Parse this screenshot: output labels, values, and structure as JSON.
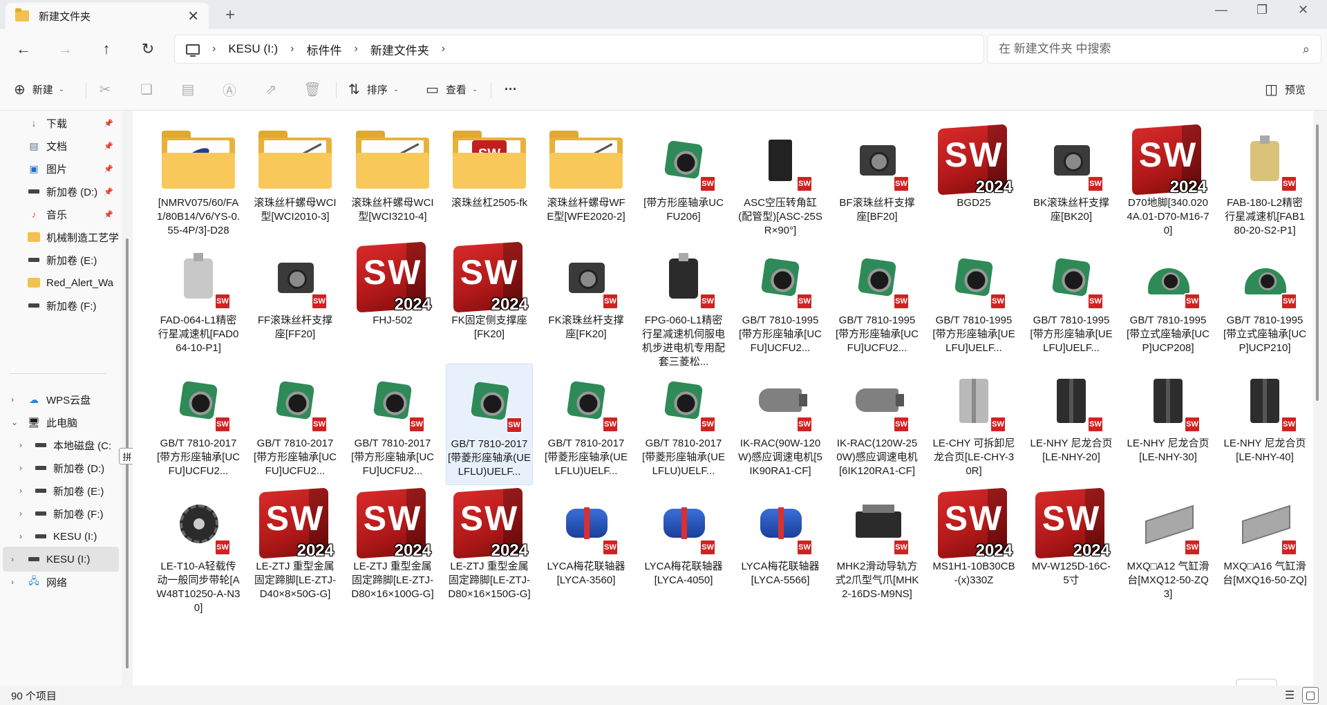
{
  "window": {
    "tab_title": "新建文件夹",
    "close_tab": "✕",
    "new_tab": "+",
    "minimize": "—",
    "restore": "❐",
    "close": "✕"
  },
  "nav": {
    "back": "←",
    "forward": "→",
    "up": "↑",
    "refresh": "↻",
    "breadcrumb": [
      "KESU (I:)",
      "标件件",
      "新建文件夹"
    ],
    "breadcrumb_sep": "›"
  },
  "search": {
    "placeholder": "在 新建文件夹 中搜索",
    "icon": "⌕"
  },
  "toolbar": {
    "new_label": "新建",
    "sort_label": "排序",
    "view_label": "查看",
    "more_label": "···",
    "preview_label": "预览"
  },
  "sidebar": {
    "quick": [
      {
        "label": "下载",
        "icon": "download-icon",
        "pinned": true
      },
      {
        "label": "文档",
        "icon": "document-icon",
        "pinned": true
      },
      {
        "label": "图片",
        "icon": "picture-icon",
        "pinned": true
      },
      {
        "label": "新加卷 (D:)",
        "icon": "drive-icon",
        "pinned": true
      },
      {
        "label": "音乐",
        "icon": "music-icon",
        "pinned": true
      },
      {
        "label": "机械制造工艺学",
        "icon": "folder-icon",
        "pinned": false
      },
      {
        "label": "新加卷 (E:)",
        "icon": "drive-icon",
        "pinned": false
      },
      {
        "label": "Red_Alert_Wa",
        "icon": "folder-icon",
        "pinned": false
      },
      {
        "label": "新加卷 (F:)",
        "icon": "drive-icon",
        "pinned": false
      }
    ],
    "tree": [
      {
        "label": "WPS云盘",
        "level": 0,
        "expander": "›"
      },
      {
        "label": "此电脑",
        "level": 0,
        "expander": "⌄"
      },
      {
        "label": "本地磁盘 (C:",
        "level": 1,
        "expander": "›"
      },
      {
        "label": "新加卷 (D:)",
        "level": 1,
        "expander": "›"
      },
      {
        "label": "新加卷 (E:)",
        "level": 1,
        "expander": "›"
      },
      {
        "label": "新加卷 (F:)",
        "level": 1,
        "expander": "›"
      },
      {
        "label": "KESU (I:)",
        "level": 1,
        "expander": "›"
      },
      {
        "label": "KESU (I:)",
        "level": 0,
        "expander": "›"
      },
      {
        "label": "网络",
        "level": 0,
        "expander": "›"
      }
    ],
    "ime_label": "拼"
  },
  "files": [
    {
      "name": "[NMRV075/60/FA1/80B14/V6/YS-0.55-4P/3]-D28",
      "kind": "folder-blob"
    },
    {
      "name": "滚珠丝杆螺母WCI型[WCI2010-3]",
      "kind": "folder-rod"
    },
    {
      "name": "滚珠丝杆螺母WCI型[WCI3210-4]",
      "kind": "folder-rod"
    },
    {
      "name": "滚珠丝杠2505-fk",
      "kind": "folder-sw"
    },
    {
      "name": "滚珠丝杆螺母WFE型[WFE2020-2]",
      "kind": "folder-rod"
    },
    {
      "name": "[带方形座轴承UCFU206]",
      "kind": "flange"
    },
    {
      "name": "ASC空压转角缸(配管型)[ASC-25SR×90°]",
      "kind": "cyl"
    },
    {
      "name": "BF滚珠丝杆支撑座[BF20]",
      "kind": "dbox"
    },
    {
      "name": "BGD25",
      "kind": "sw"
    },
    {
      "name": "BK滚珠丝杆支撑座[BK20]",
      "kind": "dbox"
    },
    {
      "name": "D70地脚[340.0204A.01-D70-M16-70]",
      "kind": "sw"
    },
    {
      "name": "FAB-180-L2精密行星减速机[FAB180-20-S2-P1]",
      "kind": "reducer-gold"
    },
    {
      "name": "FAD-064-L1精密行星减速机[FAD064-10-P1]",
      "kind": "reducer-silver"
    },
    {
      "name": "FF滚珠丝杆支撑座[FF20]",
      "kind": "dbox"
    },
    {
      "name": "FHJ-502",
      "kind": "sw"
    },
    {
      "name": "FK固定侧支撑座[FK20]",
      "kind": "sw"
    },
    {
      "name": "FK滚珠丝杆支撑座[FK20]",
      "kind": "dbox"
    },
    {
      "name": "FPG-060-L1精密行星减速机伺服电机步进电机专用配套三菱松...",
      "kind": "reducer"
    },
    {
      "name": "GB/T 7810-1995[带方形座轴承[UCFU]UCFU2...",
      "kind": "flange"
    },
    {
      "name": "GB/T 7810-1995[带方形座轴承[UCFU]UCFU2...",
      "kind": "flange"
    },
    {
      "name": "GB/T 7810-1995[带方形座轴承[UELFU]UELF...",
      "kind": "flange"
    },
    {
      "name": "GB/T 7810-1995[带方形座轴承[UELFU]UELF...",
      "kind": "flange"
    },
    {
      "name": "GB/T 7810-1995[带立式座轴承[UCP]UCP208]",
      "kind": "pillow"
    },
    {
      "name": "GB/T 7810-1995[带立式座轴承[UCP]UCP210]",
      "kind": "pillow"
    },
    {
      "name": "GB/T 7810-2017[带方形座轴承[UCFU]UCFU2...",
      "kind": "flange"
    },
    {
      "name": "GB/T 7810-2017[带方形座轴承[UCFU]UCFU2...",
      "kind": "flange"
    },
    {
      "name": "GB/T 7810-2017[带方形座轴承[UCFU]UCFU2...",
      "kind": "flange"
    },
    {
      "name": "GB/T 7810-2017[带菱形座轴承(UELFLU)UELF...",
      "kind": "flange",
      "selected": true
    },
    {
      "name": "GB/T 7810-2017[带菱形座轴承(UELFLU)UELF...",
      "kind": "flange"
    },
    {
      "name": "GB/T 7810-2017[带菱形座轴承(UELFLU)UELF...",
      "kind": "flange"
    },
    {
      "name": "IK-RAC(90W-120W)感应调速电机[5IK90RA1-CF]",
      "kind": "motor"
    },
    {
      "name": "IK-RAC(120W-250W)感应调速电机[6IK120RA1-CF]",
      "kind": "motor"
    },
    {
      "name": "LE-CHY 可拆卸尼龙合页[LE-CHY-30R]",
      "kind": "hinge-light"
    },
    {
      "name": "LE-NHY 尼龙合页[LE-NHY-20]",
      "kind": "hinge"
    },
    {
      "name": "LE-NHY 尼龙合页[LE-NHY-30]",
      "kind": "hinge"
    },
    {
      "name": "LE-NHY 尼龙合页[LE-NHY-40]",
      "kind": "hinge"
    },
    {
      "name": "LE-T10-A轻载传动一般同步带轮[AW48T10250-A-N30]",
      "kind": "gear"
    },
    {
      "name": "LE-ZTJ 重型金属固定蹄脚[LE-ZTJ-D40×8×50G-G]",
      "kind": "sw"
    },
    {
      "name": "LE-ZTJ 重型金属固定蹄脚[LE-ZTJ-D80×16×100G-G]",
      "kind": "sw"
    },
    {
      "name": "LE-ZTJ 重型金属固定蹄脚[LE-ZTJ-D80×16×150G-G]",
      "kind": "sw"
    },
    {
      "name": "LYCA梅花联轴器[LYCA-3560]",
      "kind": "coupling"
    },
    {
      "name": "LYCA梅花联轴器[LYCA-4050]",
      "kind": "coupling"
    },
    {
      "name": "LYCA梅花联轴器[LYCA-5566]",
      "kind": "coupling"
    },
    {
      "name": "MHK2滑动导轨方式2爪型气爪[MHK2-16DS-M9NS]",
      "kind": "gripper"
    },
    {
      "name": "MS1H1-10B30CB-(x)330Z",
      "kind": "sw"
    },
    {
      "name": "MV-W125D-16C-5寸",
      "kind": "sw"
    },
    {
      "name": "MXQ□A12 气缸滑台[MXQ12-50-ZQ3]",
      "kind": "slide"
    },
    {
      "name": "MXQ□A16 气缸滑台[MXQ16-50-ZQ]",
      "kind": "slide"
    }
  ],
  "sw_logo": {
    "letters": "SW",
    "year": "2024",
    "badge": "SW"
  },
  "status": {
    "count": "90 个项目"
  }
}
